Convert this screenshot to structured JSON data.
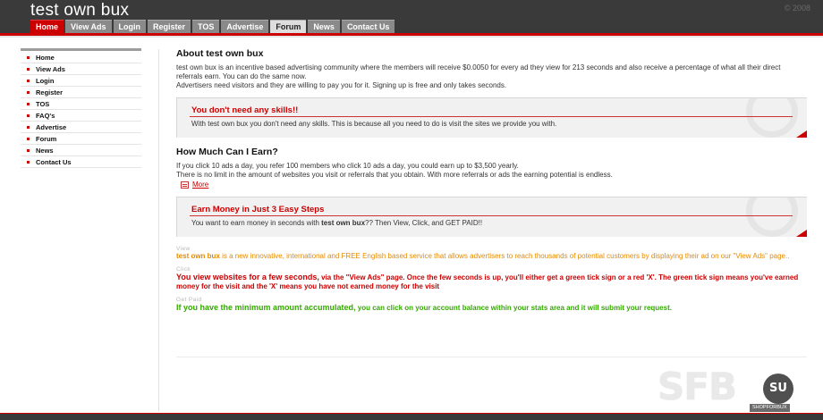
{
  "header": {
    "title": "test own bux",
    "copyright": "© 2008"
  },
  "nav": [
    {
      "label": "Home",
      "active": true
    },
    {
      "label": "View Ads"
    },
    {
      "label": "Login"
    },
    {
      "label": "Register"
    },
    {
      "label": "TOS"
    },
    {
      "label": "Advertise"
    },
    {
      "label": "Forum"
    },
    {
      "label": "News"
    },
    {
      "label": "Contact Us"
    }
  ],
  "sidebar": [
    "Home",
    "View Ads",
    "Login",
    "Register",
    "TOS",
    "FAQ's",
    "Advertise",
    "Forum",
    "News",
    "Contact Us"
  ],
  "about": {
    "title": "About test own bux",
    "p1": "test own bux is an incentive based advertising community where the members will receive $0.0050 for every ad they view for 213 seconds and also receive a percentage of what all their direct referrals earn. You can do the same now.",
    "p2": "Advertisers need visitors and they are willing to pay you for it. Signing up is free and only takes seconds."
  },
  "box1": {
    "title": "You don't need any skills!!",
    "text": "With test own bux you don't need any skills. This is because all you need to do is visit the sites we provide you with."
  },
  "earn": {
    "title": "How Much Can I Earn?",
    "p1": "If you click 10 ads a day, you refer 100 members who click 10 ads a day, you could earn up to $3,500 yearly.",
    "p2": "There is no limit in the amount of websites you visit or referrals that you obtain. With more referrals or ads the earning potential is endless.",
    "more": "More"
  },
  "box2": {
    "title": "Earn Money in Just 3 Easy Steps",
    "text_pre": "You want to earn money in seconds with ",
    "text_bold": "test own bux",
    "text_post": "?? Then View, Click, and GET PAID!!"
  },
  "steps": {
    "view_label": "View",
    "view_bold": "test own bux",
    "view_text": " is a new innovative, international and FREE English based service that allows advertisers to reach thousands of potential customers by displaying their ad on our \"View Ads\" page..",
    "click_label": "Click",
    "click_bold": "You view websites for a few seconds,",
    "click_text": " via the \"View Ads\" page. Once the few seconds is up, you'll either get a green tick sign or a red 'X'. The green tick sign means you've earned money for the visit and the 'X' means you have not earned money for the visit",
    "paid_label": "Get Paid",
    "paid_bold": "If you have the minimum amount accumulated,",
    "paid_text": " you can click on your account balance within your stats area and it will submit your request."
  },
  "watermark": {
    "letters": "SFB",
    "su": "SU",
    "tag": "SHOPFORBUX"
  },
  "colors": {
    "accent": "#cc0000",
    "header_bg": "#3a3a3a",
    "orange": "#e68a00",
    "green": "#33aa00"
  }
}
